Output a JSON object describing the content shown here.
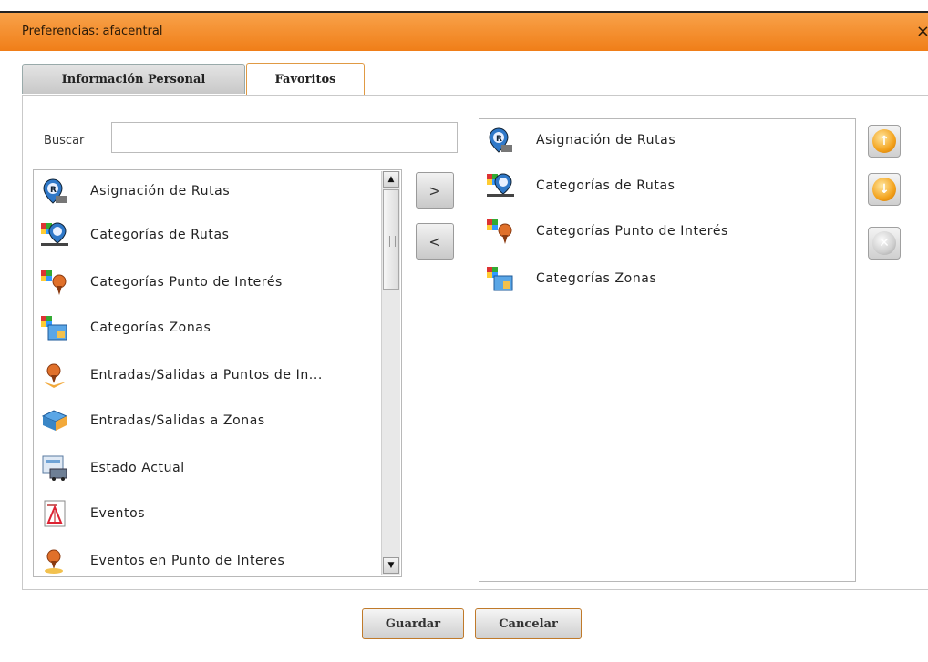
{
  "window": {
    "title": "Preferencias: afacentral",
    "close_glyph": "×"
  },
  "tabs": [
    {
      "label": "Información Personal",
      "active": false
    },
    {
      "label": "Favoritos",
      "active": true
    }
  ],
  "search": {
    "label": "Buscar",
    "value": ""
  },
  "available": {
    "items": [
      {
        "label": "Asignación de Rutas",
        "icon": "route-pin-icon"
      },
      {
        "label": "Categorías de Rutas",
        "icon": "route-category-icon"
      },
      {
        "label": "Categorías Punto de Interés",
        "icon": "poi-category-icon"
      },
      {
        "label": "Categorías Zonas",
        "icon": "zone-category-icon"
      },
      {
        "label": "Entradas/Salidas a Puntos de In...",
        "icon": "poi-entry-exit-icon"
      },
      {
        "label": "Entradas/Salidas a Zonas",
        "icon": "zone-entry-exit-icon"
      },
      {
        "label": "Estado Actual",
        "icon": "current-status-icon"
      },
      {
        "label": "Eventos",
        "icon": "events-document-icon"
      },
      {
        "label": "Eventos en Punto de Interes",
        "icon": "poi-events-icon"
      }
    ]
  },
  "favorites": {
    "items": [
      {
        "label": "Asignación de Rutas",
        "icon": "route-pin-icon"
      },
      {
        "label": "Categorías de Rutas",
        "icon": "route-category-icon"
      },
      {
        "label": "Categorías Punto de Interés",
        "icon": "poi-category-icon"
      },
      {
        "label": "Categorías Zonas",
        "icon": "zone-category-icon"
      }
    ]
  },
  "move": {
    "add_label": ">",
    "remove_label": "<"
  },
  "order_buttons": {
    "up_icon": "move-up-icon",
    "down_icon": "move-down-icon",
    "delete_icon": "delete-icon"
  },
  "footer": {
    "save_label": "Guardar",
    "cancel_label": "Cancelar"
  },
  "colors": {
    "titlebar": "#f08a2a",
    "accent_border": "#e09a44"
  }
}
